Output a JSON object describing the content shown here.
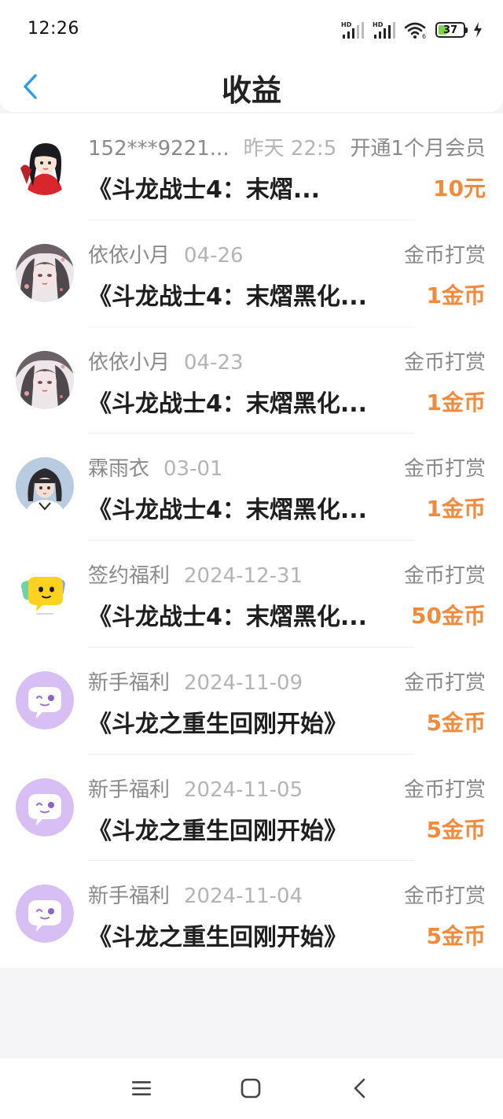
{
  "status_bar": {
    "time": "12:26",
    "battery_level": "37",
    "battery_fraction": 0.37,
    "icons": [
      "hd-signal-icon",
      "hd-signal-icon",
      "wifi-icon",
      "battery-icon",
      "charging-icon"
    ]
  },
  "header": {
    "title": "收益",
    "back_icon": "chevron-left-icon"
  },
  "colors": {
    "accent_blue": "#2f9bef",
    "amount_orange": "#f08a3c",
    "text_primary": "#1e1e1e",
    "text_secondary": "#8a8a8a",
    "text_muted": "#b4b4b4"
  },
  "entries": [
    {
      "name": "152***9221...",
      "date": "昨天 22:5",
      "type": "开通1个月会员",
      "book": "《斗龙战士4：末熠...",
      "amount": "10元",
      "avatar": "girl-red-dress-avatar"
    },
    {
      "name": "依依小月",
      "date": "04-26",
      "type": "金币打赏",
      "book": "《斗龙战士4：末熠黑化...",
      "amount": "1金币",
      "avatar": "anime-girl-flowers-avatar"
    },
    {
      "name": "依依小月",
      "date": "04-23",
      "type": "金币打赏",
      "book": "《斗龙战士4：末熠黑化...",
      "amount": "1金币",
      "avatar": "anime-girl-flowers-avatar"
    },
    {
      "name": "霖雨衣",
      "date": "03-01",
      "type": "金币打赏",
      "book": "《斗龙战士4：末熠黑化...",
      "amount": "1金币",
      "avatar": "girl-portrait-avatar"
    },
    {
      "name": "签约福利",
      "date": "2024-12-31",
      "type": "金币打赏",
      "book": "《斗龙战士4：末熠黑化...",
      "amount": "50金币",
      "avatar": "yellow-chat-bubble-avatar"
    },
    {
      "name": "新手福利",
      "date": "2024-11-09",
      "type": "金币打赏",
      "book": "《斗龙之重生回刚开始》",
      "amount": "5金币",
      "avatar": "purple-chat-bubble-avatar"
    },
    {
      "name": "新手福利",
      "date": "2024-11-05",
      "type": "金币打赏",
      "book": "《斗龙之重生回刚开始》",
      "amount": "5金币",
      "avatar": "purple-chat-bubble-avatar"
    },
    {
      "name": "新手福利",
      "date": "2024-11-04",
      "type": "金币打赏",
      "book": "《斗龙之重生回刚开始》",
      "amount": "5金币",
      "avatar": "purple-chat-bubble-avatar"
    }
  ],
  "nav_bar": {
    "icons": [
      "menu-icon",
      "home-square-icon",
      "back-triangle-icon"
    ]
  }
}
